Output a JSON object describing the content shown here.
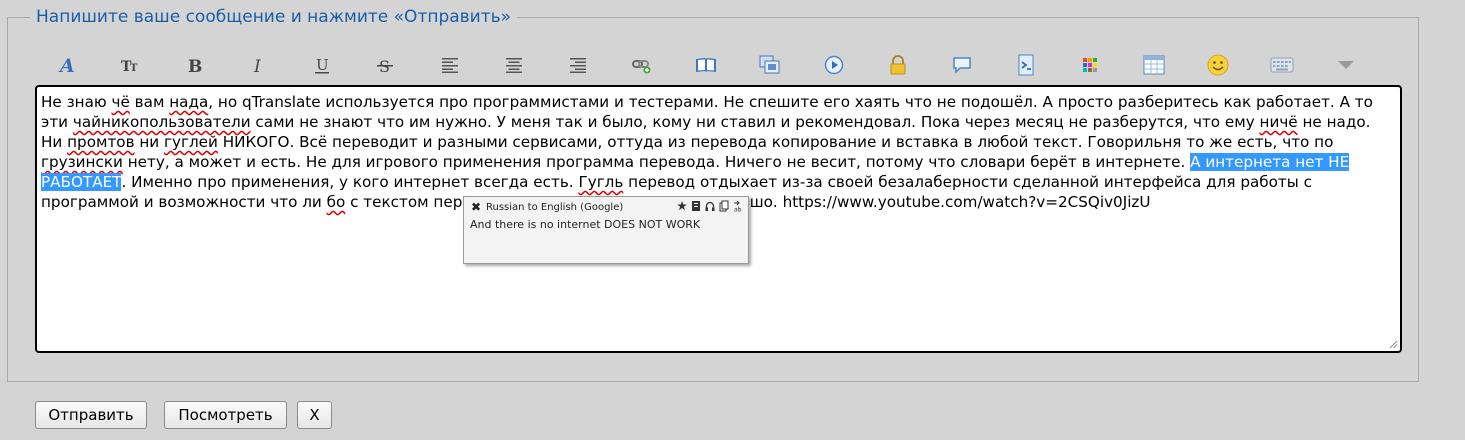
{
  "form": {
    "legend": "Напишите ваше сообщение и нажмите «Отправить»"
  },
  "toolbar": {
    "items": [
      {
        "name": "font-family-icon",
        "glyph": "A"
      },
      {
        "name": "font-size-icon",
        "glyph": "TT"
      },
      {
        "name": "bold-icon",
        "glyph": "B"
      },
      {
        "name": "italic-icon",
        "glyph": "I"
      },
      {
        "name": "underline-icon",
        "glyph": "U"
      },
      {
        "name": "strikethrough-icon",
        "glyph": "S"
      },
      {
        "name": "align-left-icon"
      },
      {
        "name": "align-center-icon"
      },
      {
        "name": "align-right-icon"
      },
      {
        "name": "link-icon"
      },
      {
        "name": "book-icon"
      },
      {
        "name": "image-icon"
      },
      {
        "name": "media-play-icon"
      },
      {
        "name": "lock-icon"
      },
      {
        "name": "speech-bubble-icon"
      },
      {
        "name": "code-icon"
      },
      {
        "name": "color-palette-icon"
      },
      {
        "name": "table-icon"
      },
      {
        "name": "smiley-icon"
      },
      {
        "name": "keyboard-icon"
      },
      {
        "name": "more-dropdown-icon"
      }
    ]
  },
  "editor": {
    "t1": "Не знаю ",
    "s1": "чё",
    "t2": " вам ",
    "s2": "нада",
    "t3": ", но qTranslate используется про программистами и тестерами. Не спешите его хаять что не подошёл. А просто разберитесь как работает. А то эти ",
    "s3": "чайникопользователи",
    "t4": " сами не знают что им нужно. У меня так и было, кому ни ставил и рекомендовал. Пока через месяц не разберутся, что ему ",
    "s4": "ничё",
    "t5": " не надо. Ни ",
    "s5": "промтов",
    "t6": " ни ",
    "s6": "гуглей",
    "t7": " НИКОГО. Всё переводит и разными сервисами, оттуда из перевода копирование и вставка в любой текст. Говорильня то же есть, что по ",
    "s7": "грузински",
    "t8": " нету, а может и есть. Не для игрового применения программа перевода. Ничего не весит, потому что словари берёт в интернете. ",
    "selected": "А интернета нет  НЕ РАБОТАЕТ",
    "t9": ". Именно про применения, у кого интернет всегда есть. ",
    "s8": "Гугль",
    "t10": " перевод отдыхает из-за своей безалаберности сделанной интерфейса для работы с программой и возможности что ли ",
    "s9": "бо",
    "t11": " с текстом перевода делать, хотя переводит хорошо. https://www.youtube.com/watch?v=2CSQiv0JizU"
  },
  "popup": {
    "title": "Russian to English (Google)",
    "translation": "And there is no internet DOES NOT WORK",
    "close": "✖"
  },
  "buttons": {
    "submit": "Отправить",
    "preview": "Посмотреть",
    "cancel": "X"
  }
}
